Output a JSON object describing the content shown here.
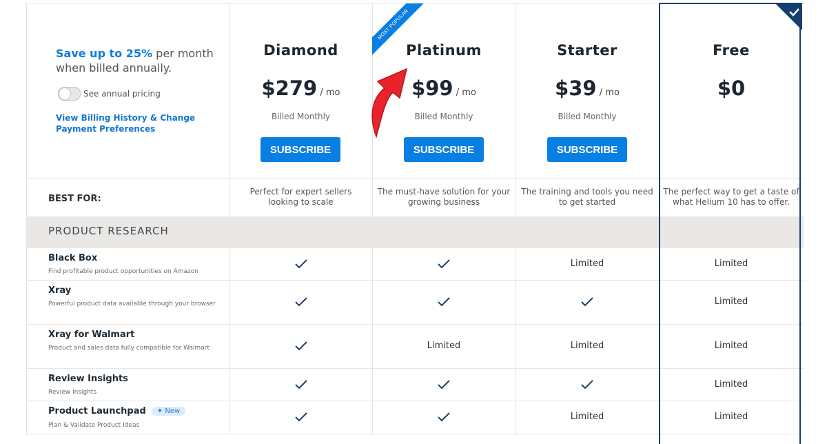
{
  "left_panel": {
    "save_highlight": "Save up to 25%",
    "save_rest": " per month when billed annually.",
    "toggle_label": "See annual pricing",
    "billing_link": "View Billing History & Change Payment Preferences"
  },
  "ribbon_text": "MOST POPULAR",
  "plans": [
    {
      "name": "Diamond",
      "price": "$279",
      "per": "/ mo",
      "billed": "Billed Monthly",
      "button": "SUBSCRIBE",
      "best_for": "Perfect for expert sellers looking to scale"
    },
    {
      "name": "Platinum",
      "price": "$99",
      "per": "/ mo",
      "billed": "Billed Monthly",
      "button": "SUBSCRIBE",
      "best_for": "The must-have solution for your growing business"
    },
    {
      "name": "Starter",
      "price": "$39",
      "per": "/ mo",
      "billed": "Billed Monthly",
      "button": "SUBSCRIBE",
      "best_for": "The training and tools you need to get started"
    },
    {
      "name": "Free",
      "price": "$0",
      "best_for": "The perfect way to get a taste of what Helium 10 has to offer."
    }
  ],
  "best_for_label": "BEST FOR:",
  "section_title": "PRODUCT RESEARCH",
  "limited_text": "Limited",
  "new_badge": "New",
  "features": [
    {
      "name": "Black Box",
      "desc": "Find profitable product opportunities on Amazon",
      "values": [
        "check",
        "check",
        "Limited",
        "Limited"
      ]
    },
    {
      "name": "Xray",
      "desc": "Powerful product data available through your browser",
      "values": [
        "check",
        "check",
        "check",
        "Limited"
      ]
    },
    {
      "name": "Xray for Walmart",
      "desc": "Product and sales data fully compatible for Walmart",
      "values": [
        "check",
        "Limited",
        "Limited",
        "Limited"
      ]
    },
    {
      "name": "Review Insights",
      "desc": "Review Insights",
      "values": [
        "check",
        "check",
        "check",
        "Limited"
      ]
    },
    {
      "name": "Product Launchpad",
      "desc": "Plan & Validate Product Ideas",
      "values": [
        "check",
        "check",
        "Limited",
        "Limited"
      ]
    }
  ],
  "colors": {
    "accent_blue": "#0a7fe3",
    "dark_navy": "#143e6b",
    "section_bg": "#ebe7e4",
    "arrow_red": "#e8242a"
  }
}
